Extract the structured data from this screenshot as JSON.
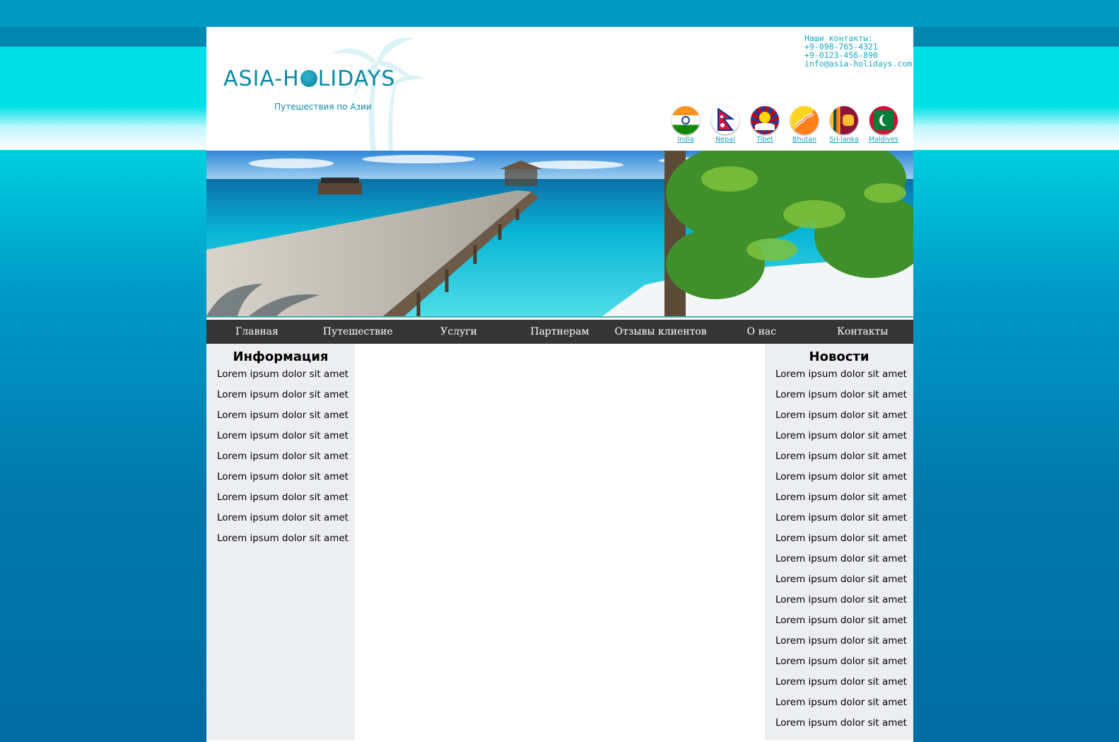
{
  "header": {
    "logo_text_left": "ASIA-H",
    "logo_text_right": "LIDAYS",
    "slogan": "Путешествия по Азии",
    "contacts": {
      "title": "Наши контакты:",
      "phone1": "+9-098-765-4321",
      "phone2": "+9-0123-456-890",
      "email": "info@asia-holidays.com"
    },
    "flags": [
      {
        "label": "India",
        "icon": "flag-india-icon"
      },
      {
        "label": "Nepal",
        "icon": "flag-nepal-icon"
      },
      {
        "label": "Tibet",
        "icon": "flag-tibet-icon"
      },
      {
        "label": "Bhutan",
        "icon": "flag-bhutan-icon"
      },
      {
        "label": "Sri-lanka",
        "icon": "flag-srilanka-icon"
      },
      {
        "label": "Maldives",
        "icon": "flag-maldives-icon"
      }
    ]
  },
  "nav": {
    "items": [
      "Главная",
      "Путешествие",
      "Услуги",
      "Партнерам",
      "Отзывы клиентов",
      "О нас",
      "Контакты"
    ]
  },
  "info": {
    "title": "Информация",
    "items": [
      "Lorem ipsum dolor sit amet",
      "Lorem ipsum dolor sit amet",
      "Lorem ipsum dolor sit amet",
      "Lorem ipsum dolor sit amet",
      "Lorem ipsum dolor sit amet",
      "Lorem ipsum dolor sit amet",
      "Lorem ipsum dolor sit amet",
      "Lorem ipsum dolor sit amet",
      "Lorem ipsum dolor sit amet"
    ]
  },
  "news": {
    "title": "Новости",
    "items": [
      "Lorem ipsum dolor sit amet",
      "Lorem ipsum dolor sit amet",
      "Lorem ipsum dolor sit amet",
      "Lorem ipsum dolor sit amet",
      "Lorem ipsum dolor sit amet",
      "Lorem ipsum dolor sit amet",
      "Lorem ipsum dolor sit amet",
      "Lorem ipsum dolor sit amet",
      "Lorem ipsum dolor sit amet",
      "Lorem ipsum dolor sit amet",
      "Lorem ipsum dolor sit amet",
      "Lorem ipsum dolor sit amet",
      "Lorem ipsum dolor sit amet",
      "Lorem ipsum dolor sit amet",
      "Lorem ipsum dolor sit amet",
      "Lorem ipsum dolor sit amet",
      "Lorem ipsum dolor sit amet",
      "Lorem ipsum dolor sit amet"
    ]
  },
  "colors": {
    "brand": "#0a8aa6",
    "link": "#1a9cc0",
    "nav_bg": "#353535",
    "sidebar_bg": "#eceef1"
  }
}
